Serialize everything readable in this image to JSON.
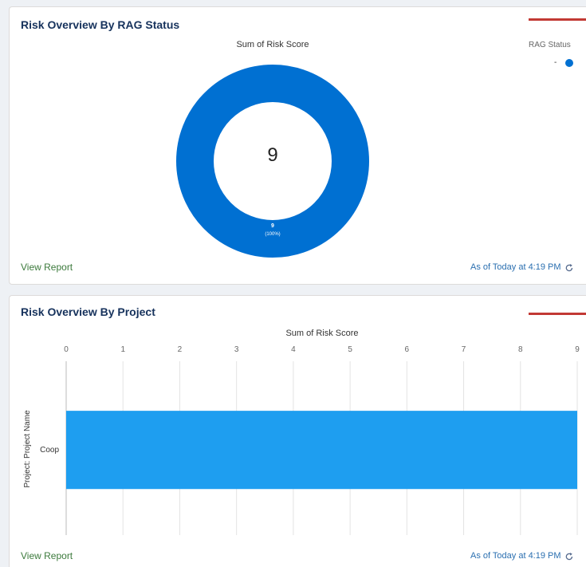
{
  "rag_card": {
    "title": "Risk Overview By RAG Status",
    "view_report": "View Report",
    "as_of": "As of Today at 4:19 PM",
    "refresh_icon": "refresh-icon",
    "accent_color": "#c23934"
  },
  "project_card": {
    "title": "Risk Overview By Project",
    "view_report": "View Report",
    "as_of": "As of Today at 4:19 PM",
    "refresh_icon": "refresh-icon",
    "accent_color": "#c23934"
  },
  "chart_data": [
    {
      "type": "pie",
      "title": "Sum of Risk Score",
      "center_label": "9",
      "legend_title": "RAG Status",
      "legend_position": "top-right",
      "slices": [
        {
          "label": "-",
          "value": 9,
          "value_label": "9",
          "percent_label": "(100%)",
          "color": "#0070d2"
        }
      ]
    },
    {
      "type": "bar",
      "orientation": "horizontal",
      "title": "Sum of Risk Score",
      "ylabel": "Project: Project Name",
      "categories": [
        "Coop"
      ],
      "values": [
        9
      ],
      "xlim": [
        0,
        9
      ],
      "x_ticks": [
        "0",
        "1",
        "2",
        "3",
        "4",
        "5",
        "6",
        "7",
        "8",
        "9"
      ],
      "grid": true,
      "bar_color": "#1e9ef0"
    }
  ]
}
